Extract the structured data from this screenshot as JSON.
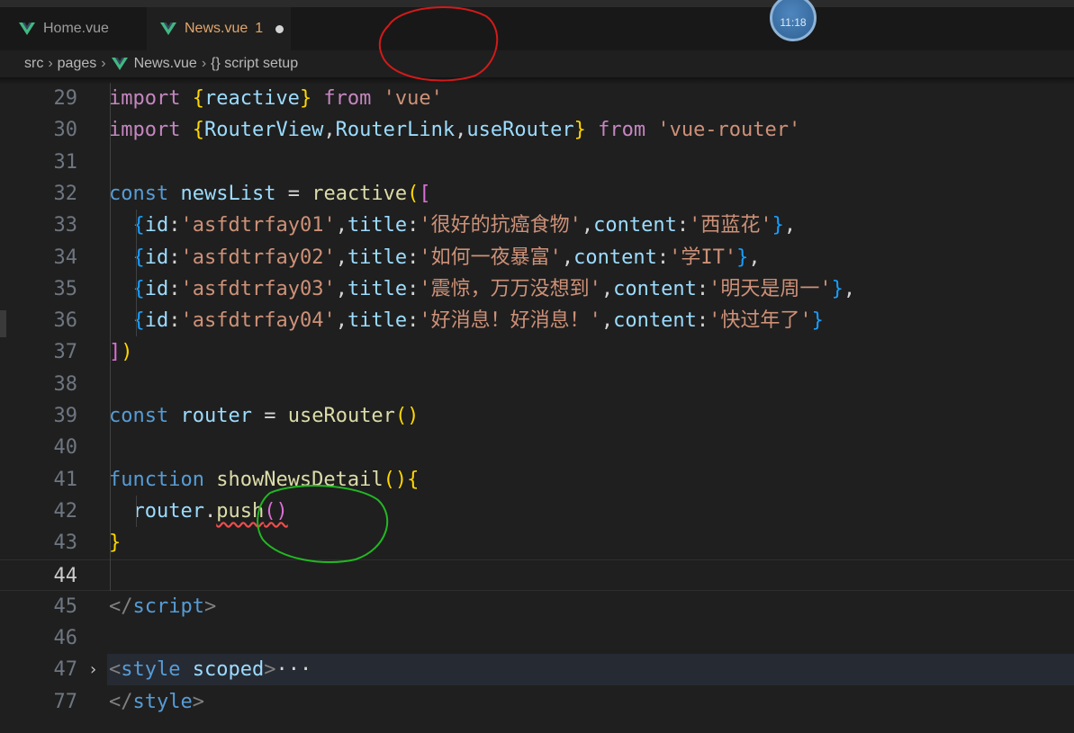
{
  "tabs": [
    {
      "label": "Home.vue",
      "active": false
    },
    {
      "label": "News.vue",
      "problems": "1",
      "active": true,
      "modified": true
    }
  ],
  "breadcrumb": {
    "folder1": "src",
    "folder2": "pages",
    "file": "News.vue",
    "symbol": "{} script setup"
  },
  "clock": "11:18",
  "colors": {
    "vue_green": "#41b883",
    "active_tab_text": "#e2a56c",
    "red_annotation": "#d21a1a",
    "green_annotation": "#22b822"
  },
  "code_lines": [
    {
      "n": "29",
      "tokens": [
        [
          "kw2",
          "import "
        ],
        [
          "p1",
          "{"
        ],
        [
          "var",
          "reactive"
        ],
        [
          "p1",
          "}"
        ],
        [
          "kw2",
          " from "
        ],
        [
          "str",
          "'vue'"
        ]
      ]
    },
    {
      "n": "30",
      "tokens": [
        [
          "kw2",
          "import "
        ],
        [
          "p1",
          "{"
        ],
        [
          "var",
          "RouterView"
        ],
        [
          "pn",
          ","
        ],
        [
          "var",
          "RouterLink"
        ],
        [
          "pn",
          ","
        ],
        [
          "var",
          "useRouter"
        ],
        [
          "p1",
          "}"
        ],
        [
          "kw2",
          " from "
        ],
        [
          "str",
          "'vue-router'"
        ]
      ]
    },
    {
      "n": "31",
      "tokens": []
    },
    {
      "n": "32",
      "tokens": [
        [
          "kw",
          "const "
        ],
        [
          "var",
          "newsList"
        ],
        [
          "pn",
          " = "
        ],
        [
          "fn",
          "reactive"
        ],
        [
          "p1",
          "("
        ],
        [
          "p2",
          "["
        ]
      ]
    },
    {
      "n": "33",
      "tokens": [
        [
          "pn",
          "  "
        ],
        [
          "p3",
          "{"
        ],
        [
          "var",
          "id"
        ],
        [
          "pn",
          ":"
        ],
        [
          "str",
          "'asfdtrfay01'"
        ],
        [
          "pn",
          ","
        ],
        [
          "var",
          "title"
        ],
        [
          "pn",
          ":"
        ],
        [
          "str",
          "'很好的抗癌食物'"
        ],
        [
          "pn",
          ","
        ],
        [
          "var",
          "content"
        ],
        [
          "pn",
          ":"
        ],
        [
          "str",
          "'西蓝花'"
        ],
        [
          "p3",
          "}"
        ],
        [
          "pn",
          ","
        ]
      ]
    },
    {
      "n": "34",
      "tokens": [
        [
          "pn",
          "  "
        ],
        [
          "p3",
          "{"
        ],
        [
          "var",
          "id"
        ],
        [
          "pn",
          ":"
        ],
        [
          "str",
          "'asfdtrfay02'"
        ],
        [
          "pn",
          ","
        ],
        [
          "var",
          "title"
        ],
        [
          "pn",
          ":"
        ],
        [
          "str",
          "'如何一夜暴富'"
        ],
        [
          "pn",
          ","
        ],
        [
          "var",
          "content"
        ],
        [
          "pn",
          ":"
        ],
        [
          "str",
          "'学IT'"
        ],
        [
          "p3",
          "}"
        ],
        [
          "pn",
          ","
        ]
      ]
    },
    {
      "n": "35",
      "tokens": [
        [
          "pn",
          "  "
        ],
        [
          "p3",
          "{"
        ],
        [
          "var",
          "id"
        ],
        [
          "pn",
          ":"
        ],
        [
          "str",
          "'asfdtrfay03'"
        ],
        [
          "pn",
          ","
        ],
        [
          "var",
          "title"
        ],
        [
          "pn",
          ":"
        ],
        [
          "str",
          "'震惊，万万没想到'"
        ],
        [
          "pn",
          ","
        ],
        [
          "var",
          "content"
        ],
        [
          "pn",
          ":"
        ],
        [
          "str",
          "'明天是周一'"
        ],
        [
          "p3",
          "}"
        ],
        [
          "pn",
          ","
        ]
      ]
    },
    {
      "n": "36",
      "tokens": [
        [
          "pn",
          "  "
        ],
        [
          "p3",
          "{"
        ],
        [
          "var",
          "id"
        ],
        [
          "pn",
          ":"
        ],
        [
          "str",
          "'asfdtrfay04'"
        ],
        [
          "pn",
          ","
        ],
        [
          "var",
          "title"
        ],
        [
          "pn",
          ":"
        ],
        [
          "str",
          "'好消息！好消息！'"
        ],
        [
          "pn",
          ","
        ],
        [
          "var",
          "content"
        ],
        [
          "pn",
          ":"
        ],
        [
          "str",
          "'快过年了'"
        ],
        [
          "p3",
          "}"
        ]
      ]
    },
    {
      "n": "37",
      "tokens": [
        [
          "p2",
          "]"
        ],
        [
          "p1",
          ")"
        ]
      ]
    },
    {
      "n": "38",
      "tokens": []
    },
    {
      "n": "39",
      "tokens": [
        [
          "kw",
          "const "
        ],
        [
          "var",
          "router"
        ],
        [
          "pn",
          " = "
        ],
        [
          "fn",
          "useRouter"
        ],
        [
          "p1",
          "()"
        ]
      ]
    },
    {
      "n": "40",
      "tokens": []
    },
    {
      "n": "41",
      "tokens": [
        [
          "kw",
          "function "
        ],
        [
          "fn",
          "showNewsDetail"
        ],
        [
          "p1",
          "()"
        ],
        [
          "p1",
          "{"
        ]
      ]
    },
    {
      "n": "42",
      "tokens": [
        [
          "pn",
          "  "
        ],
        [
          "var",
          "router"
        ],
        [
          "pn",
          "."
        ],
        [
          "fn squiggle",
          "push"
        ],
        [
          "p2 squiggle",
          "()"
        ]
      ]
    },
    {
      "n": "43",
      "tokens": [
        [
          "p1",
          "}"
        ]
      ]
    },
    {
      "n": "44",
      "tokens": [],
      "current": true
    },
    {
      "n": "45",
      "tokens": [
        [
          "tag",
          "</"
        ],
        [
          "tagname",
          "script"
        ],
        [
          "tag",
          ">"
        ]
      ]
    },
    {
      "n": "46",
      "tokens": []
    },
    {
      "n": "47",
      "tokens": [
        [
          "tag",
          "<"
        ],
        [
          "tagname",
          "style"
        ],
        [
          "attr",
          " scoped"
        ],
        [
          "tag",
          ">"
        ],
        [
          "pn",
          "···"
        ]
      ],
      "folded": true
    },
    {
      "n": "77",
      "tokens": [
        [
          "tag",
          "</"
        ],
        [
          "tagname",
          "style"
        ],
        [
          "tag",
          ">"
        ]
      ]
    }
  ]
}
